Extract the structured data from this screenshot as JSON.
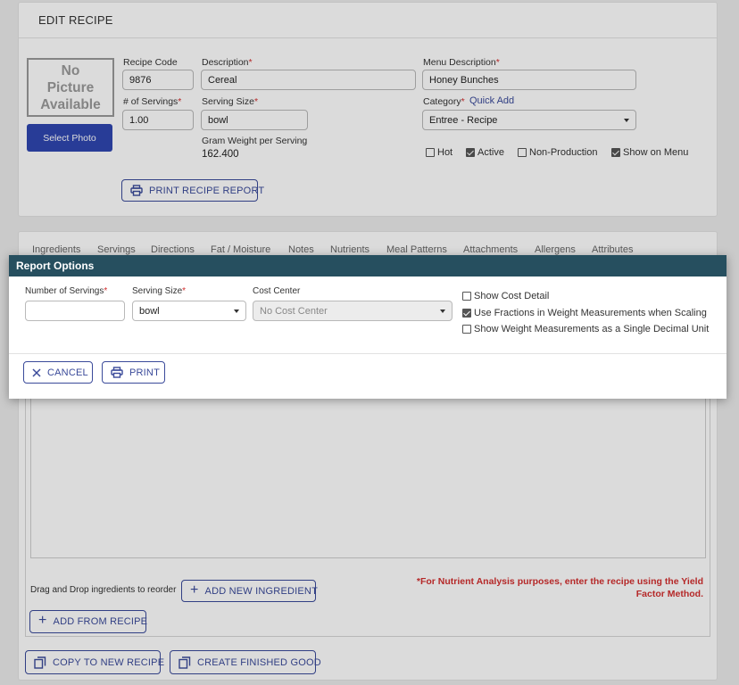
{
  "edit_recipe": {
    "header": "EDIT RECIPE",
    "picture_placeholder": [
      "No",
      "Picture",
      "Available"
    ],
    "select_photo": "Select Photo",
    "recipe_code_label": "Recipe Code",
    "recipe_code": "9876",
    "servings_label": "# of Servings",
    "servings": "1.00",
    "description_label": "Description",
    "description": "Cereal",
    "serving_size_label": "Serving Size",
    "serving_size": "bowl",
    "gram_weight_label": "Gram Weight per Serving",
    "gram_weight": "162.400",
    "menu_description_label": "Menu Description",
    "menu_description": "Honey Bunches",
    "category_label": "Category",
    "quick_add": "Quick Add",
    "category": "Entree - Recipe",
    "flags": [
      {
        "label": "Hot",
        "checked": false
      },
      {
        "label": "Active",
        "checked": true
      },
      {
        "label": "Non-Production",
        "checked": false
      },
      {
        "label": "Show on Menu",
        "checked": true
      }
    ],
    "print_report": "PRINT RECIPE REPORT"
  },
  "tabs": [
    "Ingredients",
    "Servings",
    "Directions",
    "Fat / Moisture",
    "Notes",
    "Nutrients",
    "Meal Patterns",
    "Attachments",
    "Allergens",
    "Attributes"
  ],
  "ingredients": {
    "drag_hint": "Drag and Drop ingredients to reorder",
    "add_new": "ADD NEW INGREDIENT",
    "add_from_recipe": "ADD FROM RECIPE",
    "nutrient_note": "*For Nutrient Analysis purposes, enter the recipe using the Yield Factor Method."
  },
  "footer": {
    "copy": "COPY TO NEW RECIPE",
    "create": "CREATE FINISHED GOOD"
  },
  "modal": {
    "title": "Report Options",
    "servings_label": "Number of Servings",
    "servings_value": "",
    "serving_size_label": "Serving Size",
    "serving_size": "bowl",
    "cost_center_label": "Cost Center",
    "cost_center": "No Cost Center",
    "options": [
      {
        "label": "Show Cost Detail",
        "checked": false
      },
      {
        "label": "Use Fractions in Weight Measurements when Scaling",
        "checked": true
      },
      {
        "label": "Show Weight Measurements as a Single Decimal Unit",
        "checked": false
      }
    ],
    "cancel": "CANCEL",
    "print": "PRINT"
  },
  "colors": {
    "accent": "#3a4a9a",
    "modal_header": "#264f5f",
    "required": "#d32f2f",
    "select_photo": "#2f46b0"
  }
}
